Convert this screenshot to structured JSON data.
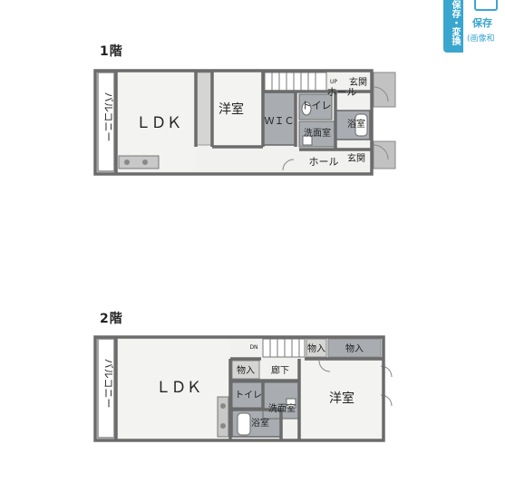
{
  "floor1": {
    "label": "1階",
    "rooms": {
      "balcony": "バルコニー",
      "ldk": "ＬＤＫ",
      "western": "洋室",
      "wic": "ＷＩＣ",
      "toilet": "トイレ",
      "washroom": "洗面室",
      "bath": "浴室",
      "hall_top": "ホール",
      "entrance_top": "玄関",
      "hall_bottom": "ホール",
      "entrance_bottom": "玄関",
      "stairs_up": "UP"
    }
  },
  "floor2": {
    "label": "2階",
    "rooms": {
      "balcony": "バルコニー",
      "ldk": "ＬＤＫ",
      "storage_left": "物入",
      "corridor": "廊下",
      "toilet": "トイレ",
      "washroom": "洗面室",
      "bath": "浴室",
      "storage_top1": "物入",
      "storage_top2": "物入",
      "western": "洋室",
      "stairs_down": "DN"
    }
  },
  "save_button": {
    "vertical_label": "保存・変換",
    "title": "保存",
    "subtitle": "(画像和"
  },
  "colors": {
    "wall": "#6b6b6b",
    "floor": "#f1f1ef",
    "wet_area": "#a9adb2",
    "accent": "#3aa6cf"
  }
}
